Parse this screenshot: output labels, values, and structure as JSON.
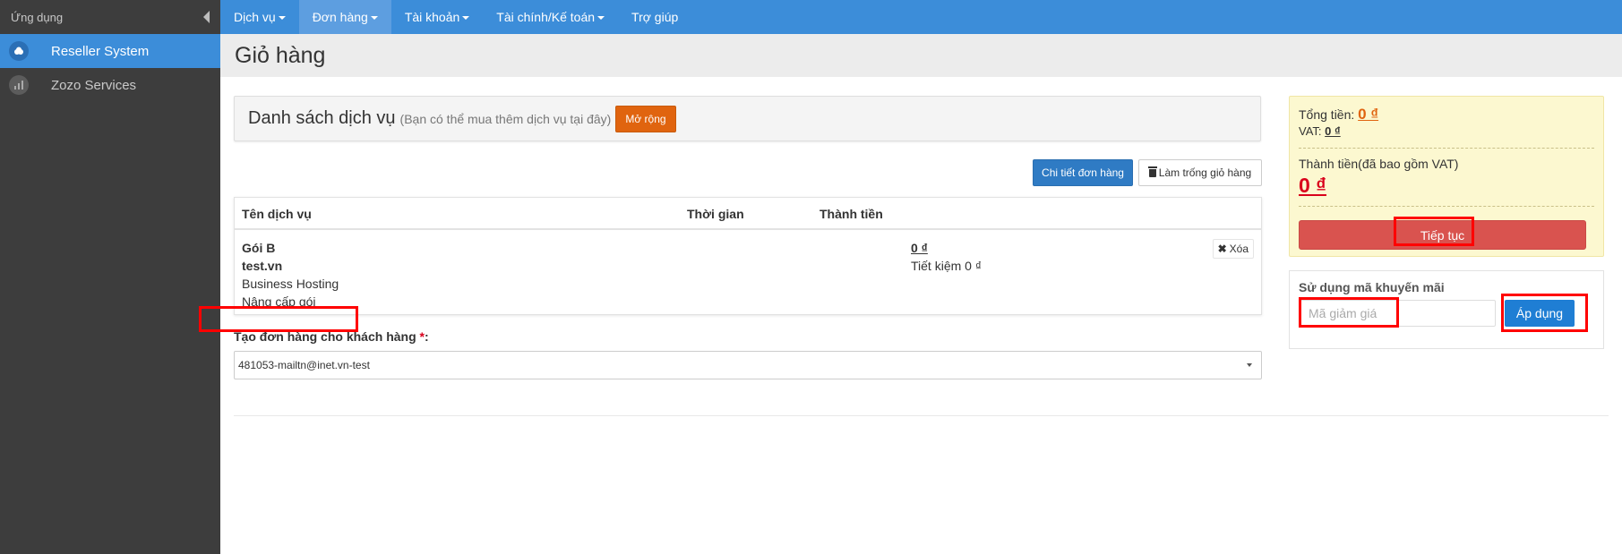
{
  "sidebar": {
    "header": "Ứng dụng",
    "items": [
      {
        "label": "Reseller System",
        "icon": "cloud-icon",
        "active": true
      },
      {
        "label": "Zozo Services",
        "icon": "chart-icon",
        "active": false
      }
    ]
  },
  "topnav": {
    "items": [
      {
        "label": "Dịch vụ",
        "dropdown": true
      },
      {
        "label": "Đơn hàng",
        "dropdown": true,
        "active": true
      },
      {
        "label": "Tài khoản",
        "dropdown": true
      },
      {
        "label": "Tài chính/Kế toán",
        "dropdown": true
      },
      {
        "label": "Trợ giúp",
        "dropdown": false
      }
    ]
  },
  "page": {
    "title": "Giỏ hàng"
  },
  "services": {
    "title": "Danh sách dịch vụ",
    "note": "(Bạn có thể mua thêm dịch vụ tại đây)",
    "expand_label": "Mở rộng",
    "detail_label": "Chi tiết đơn hàng",
    "empty_label": "Làm trống giỏ hàng"
  },
  "table": {
    "headers": [
      "Tên dịch vụ",
      "Thời gian",
      "Thành tiền"
    ],
    "rows": [
      {
        "package": "Gói B",
        "domain": "test.vn",
        "type": "Business Hosting",
        "action": "Nâng cấp gói",
        "time": "",
        "price": "0 ₫",
        "saving": "Tiết kiệm 0 ₫",
        "delete_label": "Xóa"
      }
    ]
  },
  "customer": {
    "label": "Tạo đơn hàng cho khách hàng",
    "required_mark": "*",
    "colon": ":",
    "value": "481053-mailtn@inet.vn-test"
  },
  "summary": {
    "total_label": "Tổng tiền:",
    "total_value": "0 ₫",
    "vat_label": "VAT:",
    "vat_value": "0 ₫",
    "final_label": "Thành tiền(đã bao gồm VAT)",
    "final_value": "0 ₫",
    "continue_label": "Tiếp tục"
  },
  "promo": {
    "title": "Sử dụng mã khuyến mãi",
    "placeholder": "Mã giảm giá",
    "apply_label": "Áp dụng"
  },
  "colors": {
    "primary": "#3c8dd9",
    "sidebar": "#3d3d3d",
    "orange": "#e0640f",
    "danger": "#d9534f",
    "highlight": "#ff0000"
  }
}
